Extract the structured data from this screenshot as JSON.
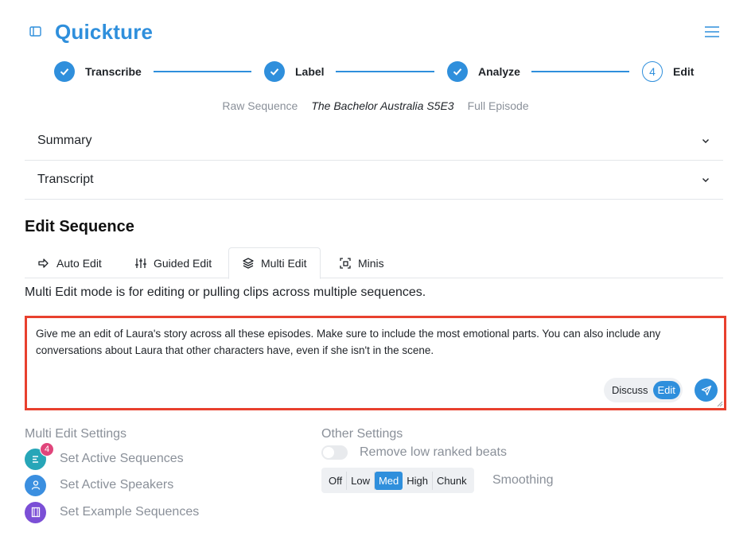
{
  "header": {
    "app_title": "Quickture",
    "sidebar_toggle_icon": "sidebar-panel-icon",
    "menu_icon": "hamburger-menu-icon",
    "brand_color": "#2f8fdc"
  },
  "stepper": {
    "steps": [
      {
        "label": "Transcribe",
        "state": "complete",
        "icon": "check-icon"
      },
      {
        "label": "Label",
        "state": "complete",
        "icon": "check-icon"
      },
      {
        "label": "Analyze",
        "state": "complete",
        "icon": "check-icon"
      },
      {
        "label": "Edit",
        "state": "current",
        "number": "4"
      }
    ]
  },
  "breadcrumb": {
    "raw": "Raw Sequence",
    "episode": "The Bachelor Australia S5E3",
    "type": "Full Episode"
  },
  "accordions": [
    {
      "label": "Summary",
      "icon": "chevron-down-icon"
    },
    {
      "label": "Transcript",
      "icon": "chevron-down-icon"
    }
  ],
  "edit": {
    "title": "Edit Sequence",
    "tabs": [
      {
        "label": "Auto Edit",
        "icon": "arrow-right-icon"
      },
      {
        "label": "Guided Edit",
        "icon": "sliders-icon"
      },
      {
        "label": "Multi Edit",
        "icon": "layers-icon",
        "active": true
      },
      {
        "label": "Minis",
        "icon": "crop-square-icon"
      }
    ],
    "mode_description": "Multi Edit mode is for editing or pulling clips across multiple sequences.",
    "prompt": "Give me an edit of Laura's story across all these episodes. Make sure to include the most emotional parts. You can also include any conversations about Laura that other characters have, even if she isn't in the scene.",
    "toggle": {
      "discuss": "Discuss",
      "edit": "Edit",
      "selected": "Edit"
    },
    "send_icon": "send-icon",
    "highlight_color": "#e8402e"
  },
  "multi_settings": {
    "title": "Multi Edit Settings",
    "items": [
      {
        "label": "Set Active Sequences",
        "icon": "list-icon",
        "color": "#27a6b8",
        "badge": "4"
      },
      {
        "label": "Set Active Speakers",
        "icon": "user-icon",
        "color": "#3b8fe0"
      },
      {
        "label": "Set Example Sequences",
        "icon": "film-icon",
        "color": "#7b4fd6"
      }
    ]
  },
  "other_settings": {
    "title": "Other Settings",
    "remove_low_ranked": {
      "label": "Remove low ranked beats",
      "enabled": false
    },
    "smoothing": {
      "label": "Smoothing",
      "options": [
        "Off",
        "Low",
        "Med",
        "High",
        "Chunk"
      ],
      "selected": "Med"
    }
  }
}
